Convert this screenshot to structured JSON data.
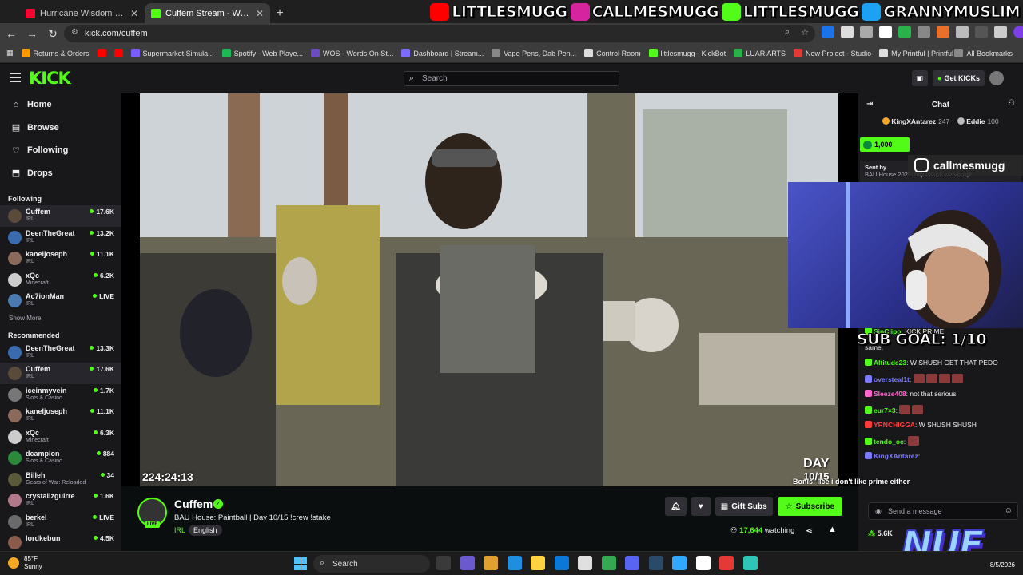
{
  "browser": {
    "tabs": [
      {
        "title": "Hurricane Wisdom - Woosah (O",
        "active": false,
        "fav_color": "#ff0033"
      },
      {
        "title": "Cuffem Stream - Watch Live on",
        "active": true,
        "fav_color": "#53fc18"
      }
    ],
    "url": "kick.com/cuffem",
    "bookmarks": [
      {
        "label": "Returns & Orders",
        "color": "#ff9900"
      },
      {
        "label": "",
        "color": "#ff0000"
      },
      {
        "label": "",
        "color": "#ff0000"
      },
      {
        "label": "Supermarket Simula...",
        "color": "#7b5cff"
      },
      {
        "label": "Spotify - Web Playe...",
        "color": "#1db954"
      },
      {
        "label": "WOS - Words On St...",
        "color": "#6b4cc4"
      },
      {
        "label": "Dashboard | Stream...",
        "color": "#7b6cff"
      },
      {
        "label": "Vape Pens, Dab Pen...",
        "color": "#888888"
      },
      {
        "label": "Control Room",
        "color": "#dddddd"
      },
      {
        "label": "littlesmugg - KickBot",
        "color": "#53fc18"
      },
      {
        "label": "LUAR ARTS",
        "color": "#2ab24a"
      },
      {
        "label": "New Project - Studio",
        "color": "#e53935"
      },
      {
        "label": "My Printful | Printful",
        "color": "#dddddd"
      }
    ],
    "all_bookmarks": "All Bookmarks"
  },
  "banner": [
    {
      "icon": "youtube-icon",
      "color": "#ff0000",
      "text": "LITTLESMUGG"
    },
    {
      "icon": "instagram-icon",
      "color": "#d6249f",
      "text": "CALLMESMUGG"
    },
    {
      "icon": "kick-icon",
      "color": "#53fc18",
      "text": "LITTLESMUGG"
    },
    {
      "icon": "twitter-icon",
      "color": "#1da1f2",
      "text": "GRANNYMUSLIM"
    }
  ],
  "kick": {
    "logo": "KICK",
    "search_placeholder": "Search",
    "get_kicks": "Get KICKs"
  },
  "nav": [
    {
      "label": "Home",
      "icon": "home-icon",
      "glyph": "⌂"
    },
    {
      "label": "Browse",
      "icon": "browse-icon",
      "glyph": "▤"
    },
    {
      "label": "Following",
      "icon": "heart-icon",
      "glyph": "♡"
    },
    {
      "label": "Drops",
      "icon": "drops-icon",
      "glyph": "⬒"
    }
  ],
  "following": {
    "heading": "Following",
    "show_more": "Show More",
    "channels": [
      {
        "name": "Cuffem",
        "category": "IRL",
        "viewers": "17.6K",
        "color": "#5a4a3a",
        "selected": true
      },
      {
        "name": "DeenTheGreat",
        "category": "IRL",
        "viewers": "13.2K",
        "color": "#3a6ab0"
      },
      {
        "name": "kaneljoseph",
        "category": "IRL",
        "viewers": "11.1K",
        "color": "#8a6a5a"
      },
      {
        "name": "xQc",
        "category": "Minecraft",
        "viewers": "6.2K",
        "color": "#cccccc"
      },
      {
        "name": "Ac7ionMan",
        "category": "IRL",
        "viewers": "LIVE",
        "color": "#4a7ab0"
      }
    ]
  },
  "recommended": {
    "heading": "Recommended",
    "channels": [
      {
        "name": "DeenTheGreat",
        "category": "IRL",
        "viewers": "13.3K",
        "color": "#3a6ab0"
      },
      {
        "name": "Cuffem",
        "category": "IRL",
        "viewers": "17.6K",
        "color": "#5a4a3a",
        "selected": true
      },
      {
        "name": "iceinmyvein",
        "category": "Slots & Casino",
        "viewers": "1.7K",
        "color": "#777777"
      },
      {
        "name": "kaneljoseph",
        "category": "IRL",
        "viewers": "11.1K",
        "color": "#8a6a5a"
      },
      {
        "name": "xQc",
        "category": "Minecraft",
        "viewers": "6.3K",
        "color": "#cccccc"
      },
      {
        "name": "dcampion",
        "category": "Slots & Casino",
        "viewers": "884",
        "color": "#2a8a3a"
      },
      {
        "name": "Billeh",
        "category": "Gears of War: Reloaded",
        "viewers": "34",
        "color": "#5a5a3a"
      },
      {
        "name": "crystalizguirre",
        "category": "IRL",
        "viewers": "1.6K",
        "color": "#b07a8a"
      },
      {
        "name": "berkel",
        "category": "IRL",
        "viewers": "LIVE",
        "color": "#6a6a6a"
      },
      {
        "name": "lordkebun",
        "category": "",
        "viewers": "4.5K",
        "color": "#8a5a4a"
      }
    ]
  },
  "video": {
    "uptime": "224:24:13",
    "day_label": "DAY",
    "day_value": "10/15",
    "instagram_handle": "callmesmugg",
    "sub_goal": "SUB GOAL: 1/10",
    "overlay_chat": "Bonis: lice i don't like prime either",
    "watermark": "NUE"
  },
  "stream": {
    "streamer": "Cuffem",
    "live_badge": "LIVE",
    "title": "BAU House: Paintball | Day 10/15  !crew !stake",
    "category": "IRL",
    "language": "English",
    "gift_subs": "Gift Subs",
    "subscribe": "Subscribe",
    "viewers": "17,644",
    "watching_label": "watching"
  },
  "chat": {
    "header": "Chat",
    "leaders": [
      {
        "name": "KingXAntarez",
        "value": "247",
        "color": "#f7a823"
      },
      {
        "name": "Eddie",
        "value": "100",
        "color": "#bbbbbb"
      }
    ],
    "kicks_total": "1,000",
    "pinned_by": "Sent by",
    "pinned_text": "BAU House 2025: https://kick.com/buspl",
    "messages": [
      {
        "user": "SinClipo",
        "color": "#53fc18",
        "text": "KICK PRIME"
      },
      {
        "user": "",
        "color": "#efeff1",
        "text": "same."
      },
      {
        "user": "Altitude23",
        "color": "#53fc18",
        "text": "W SHUSH GET THAT PEDO"
      },
      {
        "user": "oversteal1t",
        "color": "#7b7bff",
        "text": "",
        "emotes": 4
      },
      {
        "user": "Sleeze408",
        "color": "#ff66cc",
        "text": "not that serious"
      },
      {
        "user": "eur7×3",
        "color": "#53fc18",
        "text": "",
        "emotes": 2
      },
      {
        "user": "YRNCHIGGA",
        "color": "#ff3b3b",
        "text": "W SHUSH SHUSH"
      },
      {
        "user": "tendo_oc",
        "color": "#53fc18",
        "text": "",
        "emotes": 1
      },
      {
        "user": "KingXAntarez",
        "color": "#7b7bff",
        "text": ""
      }
    ],
    "input_placeholder": "Send a message",
    "kicks_balance": "5.6K"
  },
  "taskbar": {
    "temp": "85°F",
    "condition": "Sunny",
    "search": "Search",
    "date": "8/5/2026",
    "apps": [
      "#3a3a3a",
      "#6a5acd",
      "#e0a030",
      "#1e8fe0",
      "#ffd23f",
      "#0a78d7",
      "#e0e0e0",
      "#34a853",
      "#5865f2",
      "#2a4a6a",
      "#31a8ff",
      "#ffffff",
      "#e53935",
      "#2ec4b6"
    ]
  }
}
